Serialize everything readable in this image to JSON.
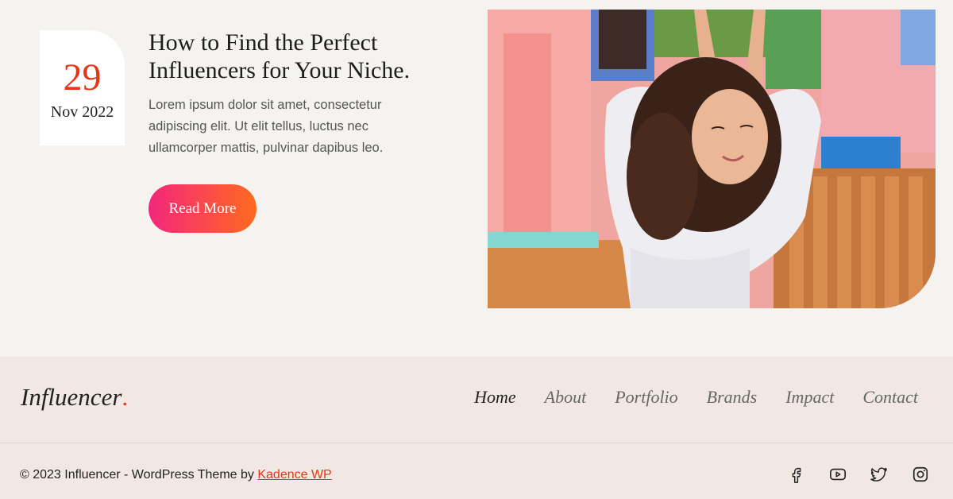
{
  "post": {
    "date_day": "29",
    "date_month": "Nov 2022",
    "title": "How to Find the Perfect Influencers for Your Niche.",
    "excerpt": "Lorem ipsum dolor sit amet, consectetur adipiscing elit. Ut elit tellus, luctus nec ullamcorper mattis, pulvinar dapibus leo.",
    "read_more_label": "Read More"
  },
  "footer": {
    "logo": "Influencer",
    "logo_dot": ".",
    "nav": [
      {
        "label": "Home"
      },
      {
        "label": "About"
      },
      {
        "label": "Portfolio"
      },
      {
        "label": "Brands"
      },
      {
        "label": "Impact"
      },
      {
        "label": "Contact"
      }
    ],
    "copyright_text": "© 2023 Influencer - WordPress Theme by ",
    "copyright_link": "Kadence WP",
    "social": [
      "facebook-icon",
      "youtube-icon",
      "twitter-icon",
      "instagram-icon"
    ]
  },
  "colors": {
    "accent": "#e63617",
    "button_start": "#f5267c",
    "button_end": "#ff6a1f",
    "page_bg": "#f5f3f0",
    "footer_bg": "#f1e8e4"
  }
}
